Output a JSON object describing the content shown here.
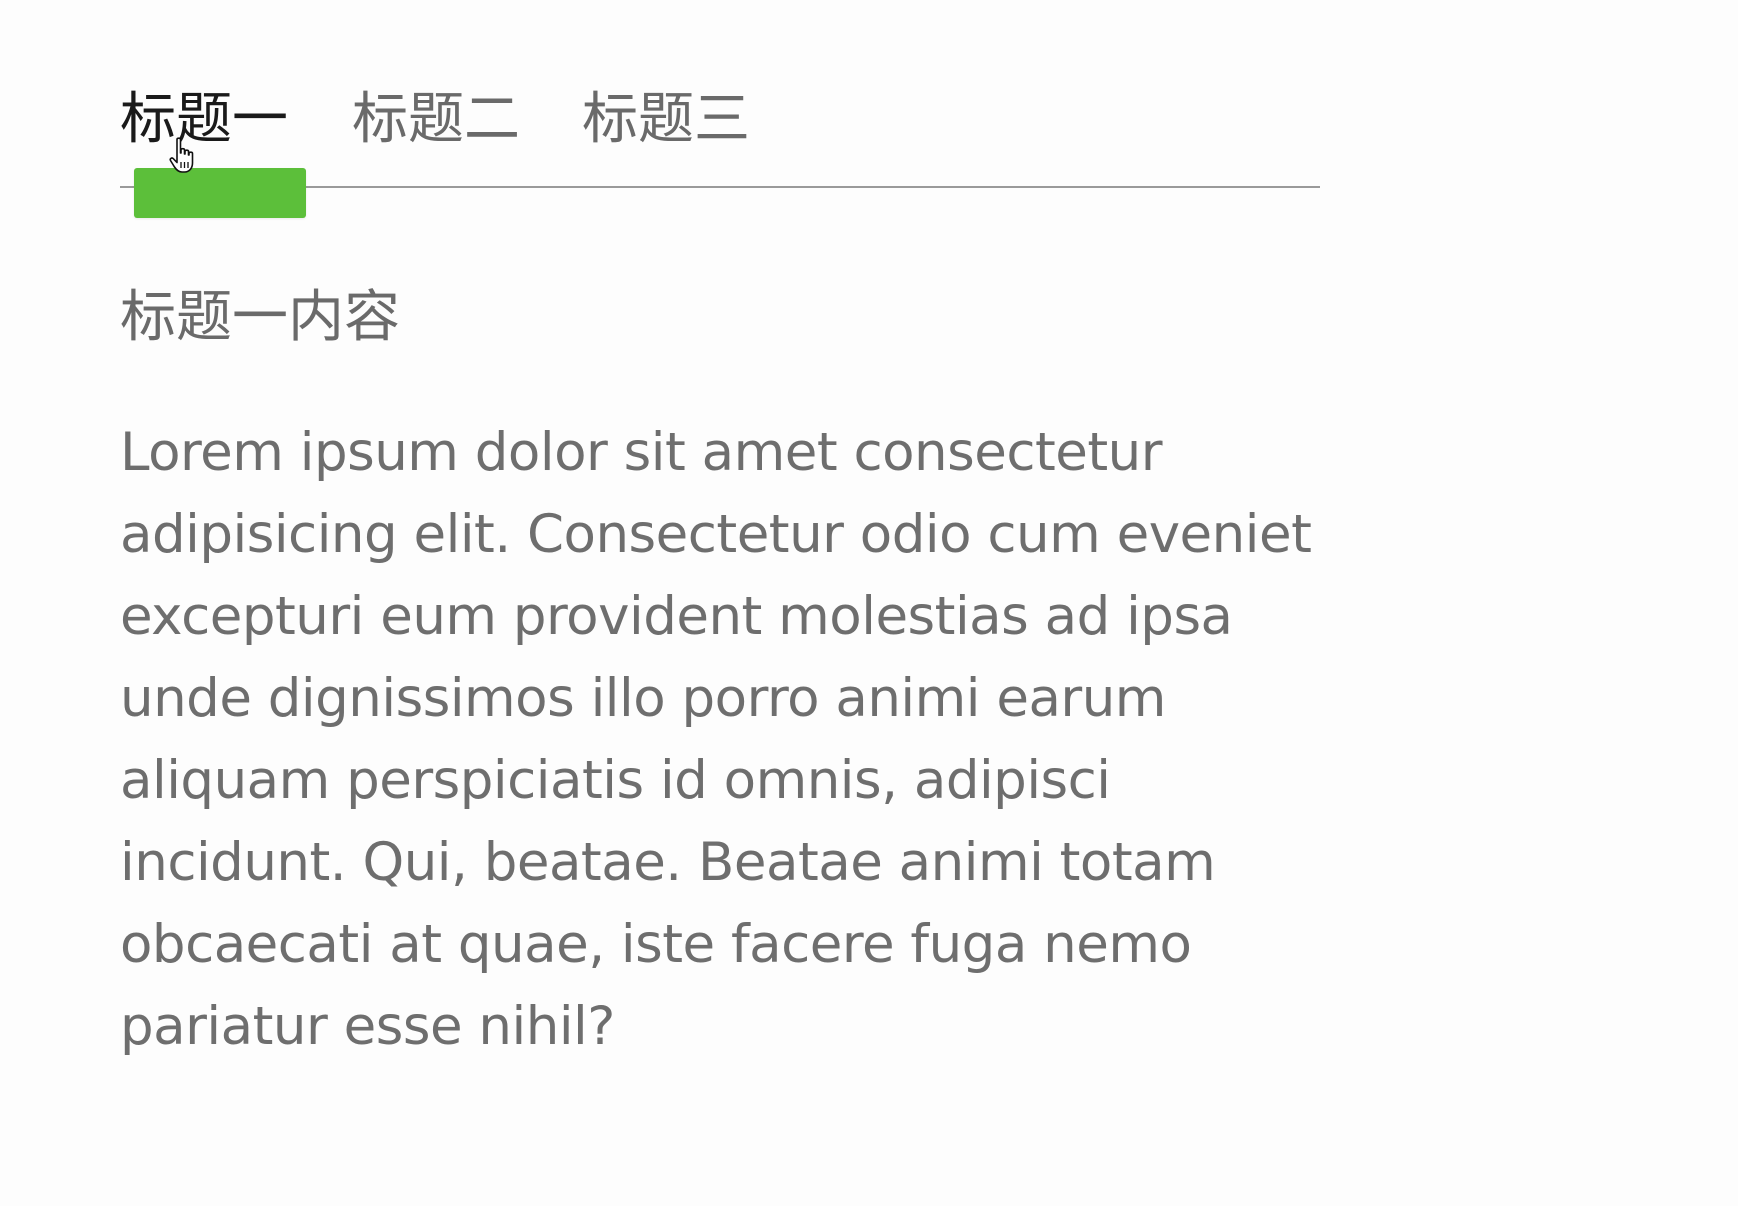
{
  "tabs": [
    {
      "label": "标题一",
      "active": true
    },
    {
      "label": "标题二",
      "active": false
    },
    {
      "label": "标题三",
      "active": false
    }
  ],
  "indicator_color": "#5cbf3a",
  "active_tab_index": 0,
  "panel": {
    "heading": "标题一内容",
    "body": "Lorem ipsum dolor sit amet consectetur adipisicing elit. Consectetur odio cum eveniet excepturi eum provident molestias ad ipsa unde dignissimos illo porro animi earum aliquam perspiciatis id omnis, adipisci incidunt. Qui, beatae. Beatae animi totam obcaecati at quae, iste facere fuga nemo pariatur esse nihil?"
  },
  "cursor": {
    "icon": "hand-pointer-icon"
  }
}
